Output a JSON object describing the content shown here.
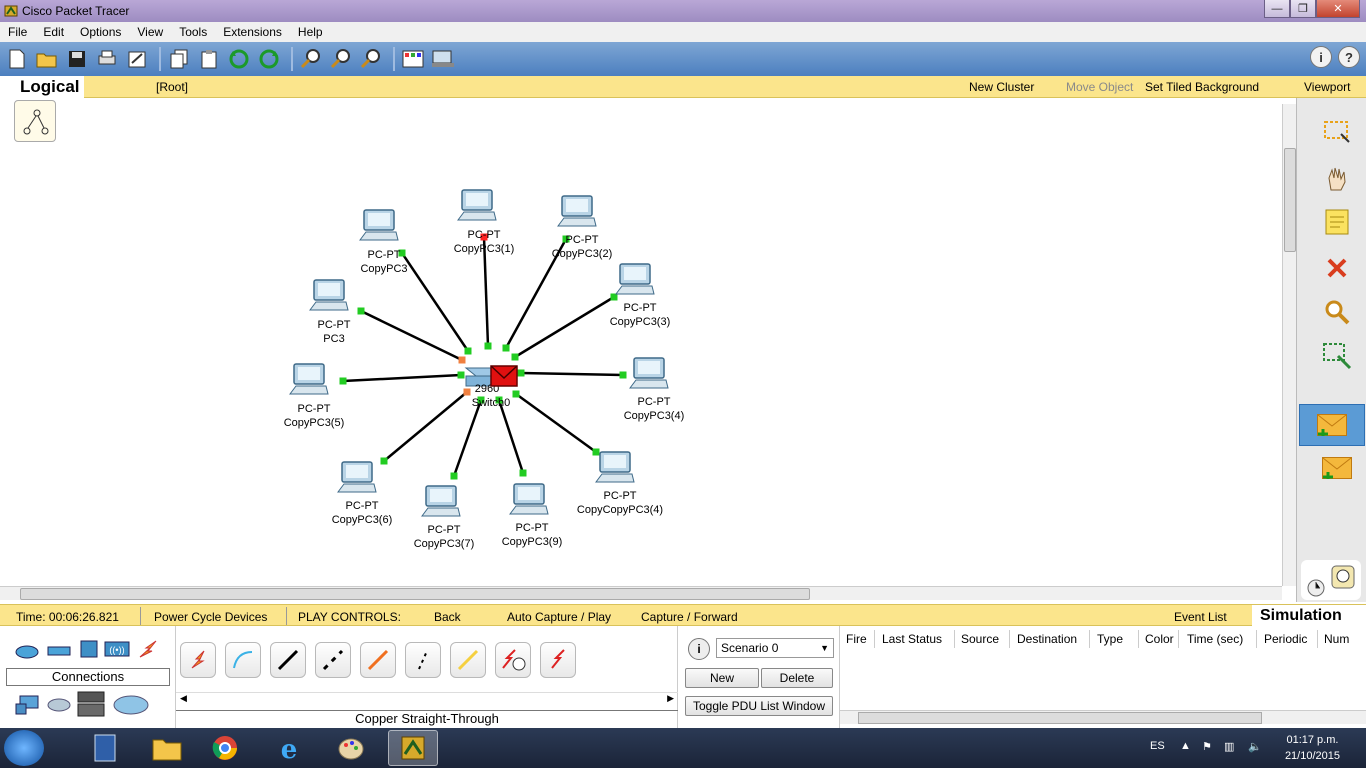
{
  "window": {
    "title": "Cisco Packet Tracer"
  },
  "menu": [
    "File",
    "Edit",
    "Options",
    "View",
    "Tools",
    "Extensions",
    "Help"
  ],
  "logical_bar": {
    "tab": "Logical",
    "root": "[Root]",
    "new_cluster": "New Cluster",
    "move_object": "Move Object",
    "set_tiled_background": "Set Tiled Background",
    "viewport": "Viewport"
  },
  "network": {
    "switch": {
      "type": "2960",
      "name": "Switch0"
    },
    "pcs": [
      {
        "type": "PC-PT",
        "name": "CopyPC3"
      },
      {
        "type": "PC-PT",
        "name": "CopyPC3(1)"
      },
      {
        "type": "PC-PT",
        "name": "CopyPC3(2)"
      },
      {
        "type": "PC-PT",
        "name": "CopyPC3(3)"
      },
      {
        "type": "PC-PT",
        "name": "PC3"
      },
      {
        "type": "PC-PT",
        "name": "CopyPC3(5)"
      },
      {
        "type": "PC-PT",
        "name": "CopyPC3(4)"
      },
      {
        "type": "PC-PT",
        "name": "CopyPC3(6)"
      },
      {
        "type": "PC-PT",
        "name": "CopyPC3(7)"
      },
      {
        "type": "PC-PT",
        "name": "CopyPC3(9)"
      },
      {
        "type": "PC-PT",
        "name": "CopyCopyPC3(4)"
      }
    ]
  },
  "status_bar": {
    "time": "Time: 00:06:26.821",
    "power_cycle": "Power Cycle Devices",
    "play_controls": "PLAY CONTROLS:",
    "back": "Back",
    "auto_capture": "Auto Capture / Play",
    "capture_forward": "Capture / Forward",
    "event_list": "Event List",
    "mode": "Simulation"
  },
  "device_panel": {
    "connections_label": "Connections"
  },
  "cable_panel": {
    "selected": "Copper Straight-Through"
  },
  "scenario": {
    "selected": "Scenario 0",
    "new": "New",
    "delete": "Delete",
    "toggle_pdu": "Toggle PDU List Window"
  },
  "event_table": {
    "columns": [
      "Fire",
      "Last Status",
      "Source",
      "Destination",
      "Type",
      "Color",
      "Time (sec)",
      "Periodic",
      "Num"
    ],
    "rows": []
  },
  "taskbar": {
    "lang": "ES",
    "time": "01:17 p.m.",
    "date": "21/10/2015"
  },
  "colors": {
    "link_up": "#22cc22",
    "link_down": "#ff2222",
    "link_blocking": "#f08040",
    "pdu": "#e01010",
    "yellow_bar": "#fbe58c"
  }
}
